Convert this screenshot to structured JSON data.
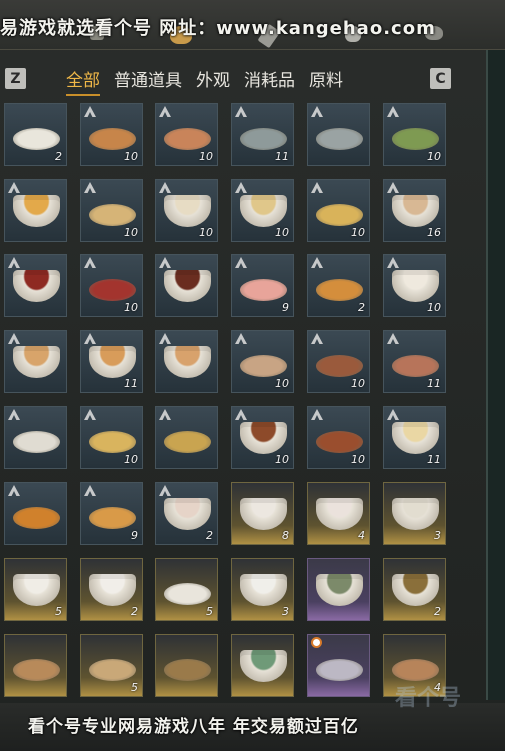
{
  "watermark": {
    "top": "易游戏就选看个号  网址：www.kangehao.com",
    "bottom": "看个号专业网易游戏八年  年交易额过百亿"
  },
  "keys": {
    "left": "Z",
    "right": "C"
  },
  "tabs": [
    {
      "label": "全部",
      "active": true
    },
    {
      "label": "普通道具",
      "active": false
    },
    {
      "label": "外观",
      "active": false
    },
    {
      "label": "消耗品",
      "active": false
    },
    {
      "label": "原料",
      "active": false
    }
  ],
  "items": [
    {
      "name": "rice-dumplings",
      "count": "2",
      "rank": false,
      "style": "gray",
      "food": "#e9e6dc"
    },
    {
      "name": "spiced-pastry",
      "count": "10",
      "rank": true,
      "style": "gray",
      "food": "#c7854a"
    },
    {
      "name": "sliced-meat-plate",
      "count": "10",
      "rank": true,
      "style": "gray",
      "food": "#c9845a"
    },
    {
      "name": "clam-dish",
      "count": "11",
      "rank": true,
      "style": "gray",
      "food": "#8e9a9a"
    },
    {
      "name": "seafood-plate",
      "count": "",
      "rank": true,
      "style": "gray",
      "food": "#9aa3a3"
    },
    {
      "name": "greens-plate",
      "count": "10",
      "rank": true,
      "style": "gray",
      "food": "#7e9a52"
    },
    {
      "name": "egg-soup-bowl",
      "count": "",
      "rank": true,
      "style": "gray",
      "food": "#e3a94a"
    },
    {
      "name": "pancake-stack",
      "count": "10",
      "rank": true,
      "style": "gray",
      "food": "#d6b477"
    },
    {
      "name": "steamed-buns",
      "count": "10",
      "rank": true,
      "style": "gray",
      "food": "#e7dcc4"
    },
    {
      "name": "noodle-bowl",
      "count": "10",
      "rank": true,
      "style": "gray",
      "food": "#e0c78a"
    },
    {
      "name": "fried-noodles",
      "count": "10",
      "rank": true,
      "style": "gray",
      "food": "#d9b35a"
    },
    {
      "name": "congee-bowl",
      "count": "16",
      "rank": true,
      "style": "gray",
      "food": "#d8b894"
    },
    {
      "name": "red-bean-soup",
      "count": "",
      "rank": true,
      "style": "gray",
      "food": "#8e2a22"
    },
    {
      "name": "braised-dish",
      "count": "10",
      "rank": true,
      "style": "gray",
      "food": "#a3342e"
    },
    {
      "name": "tea-cup",
      "count": "",
      "rank": true,
      "style": "gray",
      "food": "#6a2d20"
    },
    {
      "name": "sashimi-plate",
      "count": "9",
      "rank": true,
      "style": "gray",
      "food": "#e8a49a"
    },
    {
      "name": "fried-rice",
      "count": "2",
      "rank": true,
      "style": "gray",
      "food": "#d48e3c"
    },
    {
      "name": "dumpling-bowl",
      "count": "10",
      "rank": true,
      "style": "gray",
      "food": "#efe9de"
    },
    {
      "name": "wonton-soup",
      "count": "",
      "rank": true,
      "style": "gray",
      "food": "#d8a46a"
    },
    {
      "name": "broth-bowl",
      "count": "11",
      "rank": true,
      "style": "gray",
      "food": "#d89c5a"
    },
    {
      "name": "clear-soup",
      "count": "",
      "rank": true,
      "style": "gray",
      "food": "#d8a26c"
    },
    {
      "name": "meatball-plate",
      "count": "10",
      "rank": true,
      "style": "gray",
      "food": "#c8a484"
    },
    {
      "name": "roast-duck-slices",
      "count": "10",
      "rank": true,
      "style": "gray",
      "food": "#9a5a3c"
    },
    {
      "name": "pork-stew-bowl",
      "count": "11",
      "rank": true,
      "style": "gray",
      "food": "#b7745a"
    },
    {
      "name": "rice-porridge",
      "count": "",
      "rank": true,
      "style": "gray",
      "food": "#e0dcd2"
    },
    {
      "name": "egg-noodles",
      "count": "10",
      "rank": true,
      "style": "gray",
      "food": "#d9b45e"
    },
    {
      "name": "stir-fry-noodles",
      "count": "",
      "rank": true,
      "style": "gray",
      "food": "#c9a450"
    },
    {
      "name": "clay-pot-stew",
      "count": "10",
      "rank": true,
      "style": "gray",
      "food": "#8d4a2a"
    },
    {
      "name": "braised-pork",
      "count": "10",
      "rank": true,
      "style": "gray",
      "food": "#9a4e2e"
    },
    {
      "name": "tofu-pudding",
      "count": "11",
      "rank": true,
      "style": "gray",
      "food": "#ead7a4"
    },
    {
      "name": "fried-pastries",
      "count": "",
      "rank": true,
      "style": "gray",
      "food": "#d0812c"
    },
    {
      "name": "layered-cake",
      "count": "9",
      "rank": true,
      "style": "gray",
      "food": "#d99a48"
    },
    {
      "name": "glutinous-ball",
      "count": "2",
      "rank": true,
      "style": "gray",
      "food": "#e6d4c8"
    },
    {
      "name": "porcelain-bowl-red",
      "count": "8",
      "rank": false,
      "style": "gold",
      "food": "#ece7e0"
    },
    {
      "name": "porcelain-bowl-flower",
      "count": "4",
      "rank": false,
      "style": "gold",
      "food": "#ebe2dc"
    },
    {
      "name": "celadon-bowl",
      "count": "3",
      "rank": false,
      "style": "gold",
      "food": "#e2ddd0"
    },
    {
      "name": "white-bowl",
      "count": "5",
      "rank": false,
      "style": "gold",
      "food": "#f0ede6"
    },
    {
      "name": "lidded-bowl",
      "count": "2",
      "rank": false,
      "style": "gold",
      "food": "#f1eee9"
    },
    {
      "name": "shallow-dish",
      "count": "5",
      "rank": false,
      "style": "gold",
      "food": "#e9e5dc"
    },
    {
      "name": "blue-rim-bowl",
      "count": "3",
      "rank": false,
      "style": "gold",
      "food": "#f0efea"
    },
    {
      "name": "green-vase",
      "count": "",
      "rank": false,
      "style": "purple",
      "food": "#7c8a6a"
    },
    {
      "name": "bronze-seal",
      "count": "2",
      "rank": false,
      "style": "gold",
      "food": "#8a6f3a"
    },
    {
      "name": "bamboo-slips",
      "count": "",
      "rank": false,
      "style": "gold",
      "food": "#b88a5a"
    },
    {
      "name": "paper-scroll",
      "count": "5",
      "rank": false,
      "style": "gold",
      "food": "#c9a878"
    },
    {
      "name": "wooden-frame",
      "count": "",
      "rank": false,
      "style": "gold",
      "food": "#9a7a4a"
    },
    {
      "name": "celadon-teapot",
      "count": "",
      "rank": false,
      "style": "gold",
      "food": "#6f9a78"
    },
    {
      "name": "token-card",
      "count": "",
      "rank": false,
      "timer": true,
      "style": "purple",
      "food": "#bcb8c4"
    },
    {
      "name": "sesame-flatbread",
      "count": "4",
      "rank": false,
      "style": "gold",
      "food": "#b7845a"
    }
  ]
}
